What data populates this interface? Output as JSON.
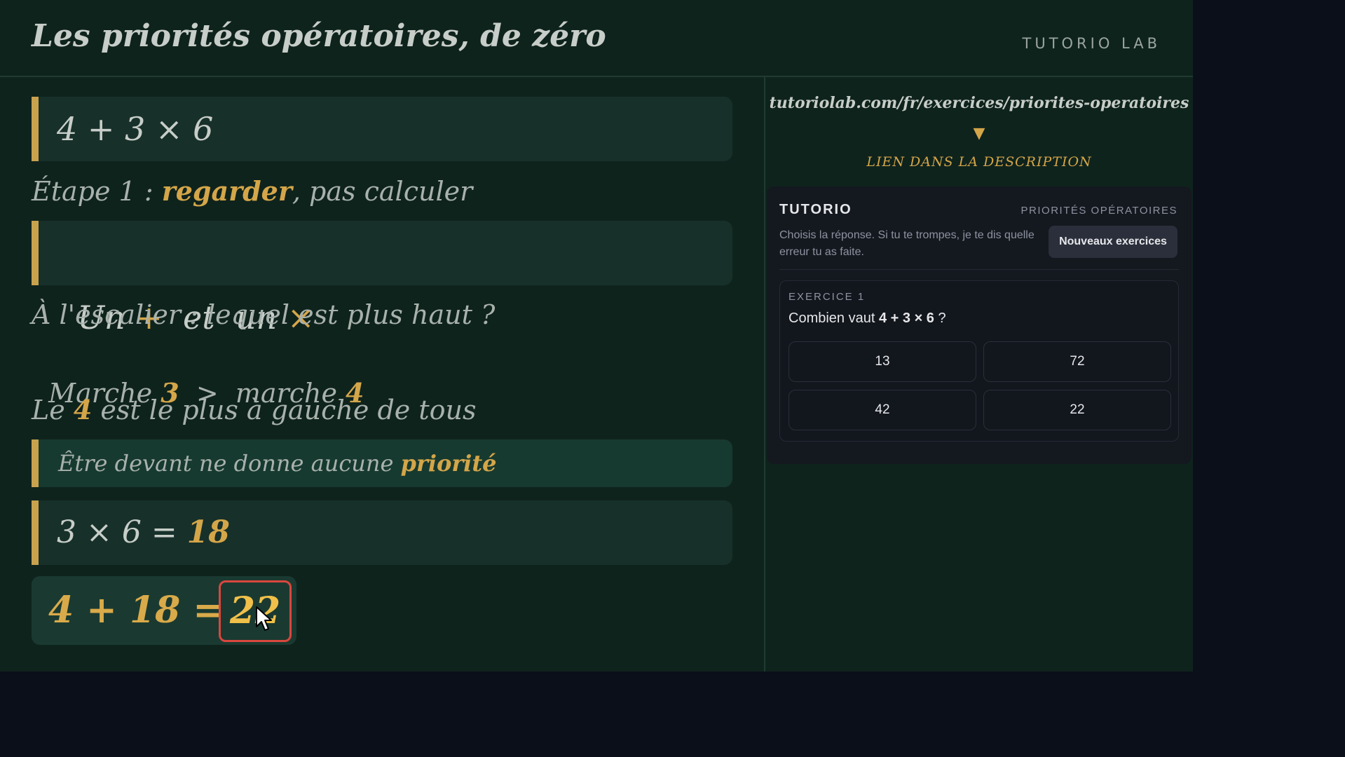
{
  "header": {
    "title": "Les priorités opératoires, de zéro",
    "brand": "TUTORIO LAB"
  },
  "lesson": {
    "expr1": "4 + 3 × 6",
    "step1_prefix": "Étape 1 : ",
    "step1_keyword": "regarder",
    "step1_suffix": ", pas calculer",
    "box2": {
      "a": "Un ",
      "plus": "+",
      "b": "  et  un ",
      "times": "×"
    },
    "question": "À l'escalier : lequel est plus haut ?",
    "compare": {
      "a": "Marche ",
      "n1": "3",
      "b": "  >  marche ",
      "n2": "4"
    },
    "left_line": {
      "a": "Le ",
      "n": "4",
      "b": " est le plus à gauche de tous"
    },
    "note": {
      "a": "Être devant ne donne aucune ",
      "keyword": "priorité"
    },
    "calc": {
      "a": "3 × 6 = ",
      "result": "18"
    },
    "final": {
      "expr": "4 + 18 =",
      "answer": "22"
    }
  },
  "promo": {
    "url": "tutoriolab.com/fr/exercices/priorites-operatoires",
    "arrow": "▼",
    "link": "LIEN DANS LA DESCRIPTION"
  },
  "card": {
    "brand": "TUTORIO",
    "topic": "PRIORITÉS OPÉRATOIRES",
    "desc": "Choisis la réponse. Si tu te trompes, je te dis quelle erreur tu as faite.",
    "new_button": "Nouveaux exercices",
    "exercise": {
      "label": "EXERCICE 1",
      "q_prefix": "Combien vaut ",
      "q_expr": "4 + 3 × 6",
      "q_suffix": " ?",
      "options": [
        "13",
        "72",
        "42",
        "22"
      ]
    }
  },
  "colors": {
    "board": "#0f231d",
    "accent_gold": "#d4a649",
    "highlight_red": "#d9473e"
  }
}
